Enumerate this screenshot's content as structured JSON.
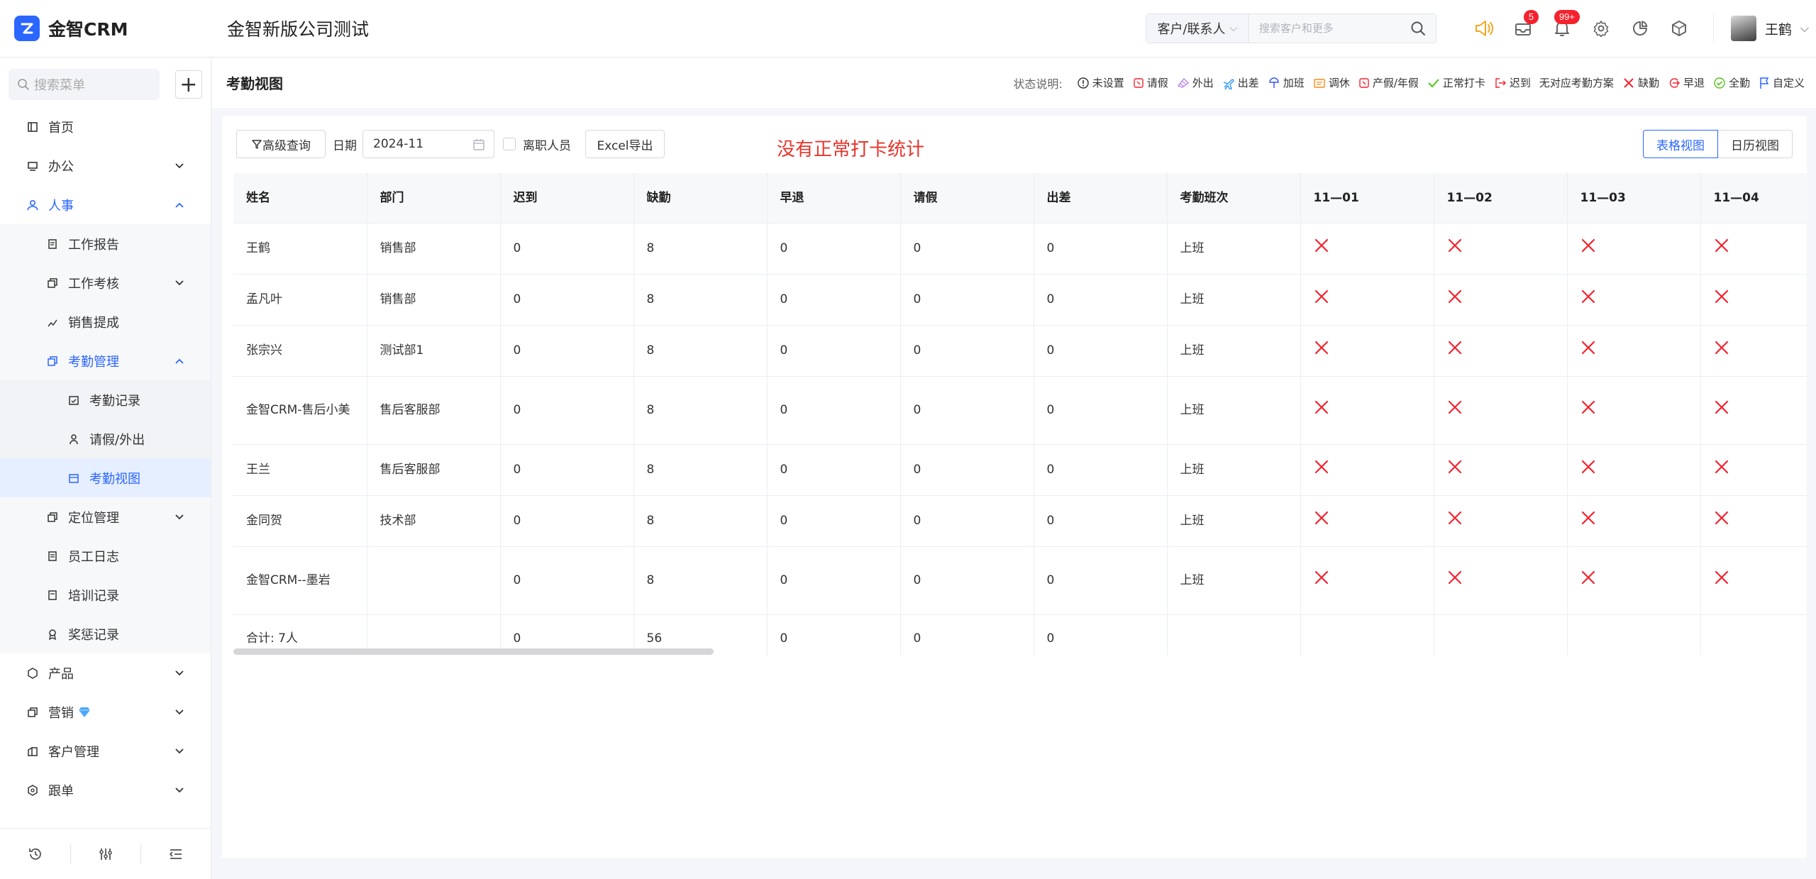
{
  "app": {
    "brand": "金智CRM",
    "company": "金智新版公司测试"
  },
  "header": {
    "search_scope": "客户/联系人",
    "search_placeholder": "搜索客户和更多",
    "mail_badge": "5",
    "notify_badge": "99+",
    "user_name": "王鹤"
  },
  "sidebar": {
    "search_placeholder": "搜索菜单",
    "items": {
      "home": "首页",
      "office": "办公",
      "hr": "人事",
      "work_report": "工作报告",
      "work_assess": "工作考核",
      "sales_commission": "销售提成",
      "attendance_mgmt": "考勤管理",
      "attendance_record": "考勤记录",
      "leave_out": "请假/外出",
      "attendance_view": "考勤视图",
      "location_mgmt": "定位管理",
      "staff_log": "员工日志",
      "training_record": "培训记录",
      "reward_record": "奖惩记录",
      "product": "产品",
      "marketing": "营销",
      "customer_mgmt": "客户管理",
      "follow_order": "跟单"
    }
  },
  "page": {
    "title": "考勤视图",
    "legend_title": "状态说明:",
    "legend": [
      {
        "label": "未设置",
        "icon": "info-circle-icon",
        "color": "#333333"
      },
      {
        "label": "请假",
        "icon": "leave-icon",
        "color": "#f5222d"
      },
      {
        "label": "外出",
        "icon": "out-icon",
        "color": "#b37feb"
      },
      {
        "label": "出差",
        "icon": "plane-icon",
        "color": "#1890ff"
      },
      {
        "label": "加班",
        "icon": "overtime-icon",
        "color": "#2f54eb"
      },
      {
        "label": "调休",
        "icon": "swap-rest-icon",
        "color": "#fa8c16"
      },
      {
        "label": "产假/年假",
        "icon": "vacation-icon",
        "color": "#f5222d"
      },
      {
        "label": "正常打卡",
        "icon": "check-icon",
        "color": "#52c41a"
      },
      {
        "label": "迟到",
        "icon": "late-icon",
        "color": "#f5222d"
      },
      {
        "label": "无对应考勤方案",
        "icon": "",
        "color": "#333333"
      },
      {
        "label": "缺勤",
        "icon": "absent-x-icon",
        "color": "#f5222d"
      },
      {
        "label": "早退",
        "icon": "early-leave-icon",
        "color": "#f5222d"
      },
      {
        "label": "全勤",
        "icon": "full-attendance-icon",
        "color": "#52c41a"
      },
      {
        "label": "自定义",
        "icon": "flag-icon",
        "color": "#2b66ff"
      }
    ]
  },
  "toolbar": {
    "advanced_query": "高级查询",
    "date_label": "日期",
    "date_value": "2024-11",
    "resigned_label": "离职人员",
    "export_label": "Excel导出",
    "annotation": "没有正常打卡统计",
    "view_table": "表格视图",
    "view_calendar": "日历视图"
  },
  "table": {
    "columns": [
      "姓名",
      "部门",
      "迟到",
      "缺勤",
      "早退",
      "请假",
      "出差",
      "考勤班次",
      "11—01",
      "11—02",
      "11—03",
      "11—04"
    ],
    "rows": [
      {
        "name": "王鹤",
        "dept": "销售部",
        "late": "0",
        "absent": "8",
        "early": "0",
        "leave": "0",
        "trip": "0",
        "shift": "上班",
        "days": [
          "absent",
          "absent",
          "absent",
          "absent"
        ]
      },
      {
        "name": "孟凡叶",
        "dept": "销售部",
        "late": "0",
        "absent": "8",
        "early": "0",
        "leave": "0",
        "trip": "0",
        "shift": "上班",
        "days": [
          "absent",
          "absent",
          "absent",
          "absent"
        ]
      },
      {
        "name": "张宗兴",
        "dept": "测试部1",
        "late": "0",
        "absent": "8",
        "early": "0",
        "leave": "0",
        "trip": "0",
        "shift": "上班",
        "days": [
          "absent",
          "absent",
          "absent",
          "absent"
        ]
      },
      {
        "name": "金智CRM-售后小美",
        "dept": "售后客服部",
        "late": "0",
        "absent": "8",
        "early": "0",
        "leave": "0",
        "trip": "0",
        "shift": "上班",
        "days": [
          "absent",
          "absent",
          "absent",
          "absent"
        ]
      },
      {
        "name": "王兰",
        "dept": "售后客服部",
        "late": "0",
        "absent": "8",
        "early": "0",
        "leave": "0",
        "trip": "0",
        "shift": "上班",
        "days": [
          "absent",
          "absent",
          "absent",
          "absent"
        ]
      },
      {
        "name": "金同贺",
        "dept": "技术部",
        "late": "0",
        "absent": "8",
        "early": "0",
        "leave": "0",
        "trip": "0",
        "shift": "上班",
        "days": [
          "absent",
          "absent",
          "absent",
          "absent"
        ]
      },
      {
        "name": "金智CRM--墨岩",
        "dept": "",
        "late": "0",
        "absent": "8",
        "early": "0",
        "leave": "0",
        "trip": "0",
        "shift": "上班",
        "days": [
          "absent",
          "absent",
          "absent",
          "absent"
        ]
      }
    ],
    "total": {
      "label": "合计: 7人",
      "late": "0",
      "absent": "56",
      "early": "0",
      "leave": "0",
      "trip": "0"
    }
  },
  "colors": {
    "accent": "#2b66ff",
    "absent": "#f5222d",
    "annotation": "#e5352b"
  }
}
